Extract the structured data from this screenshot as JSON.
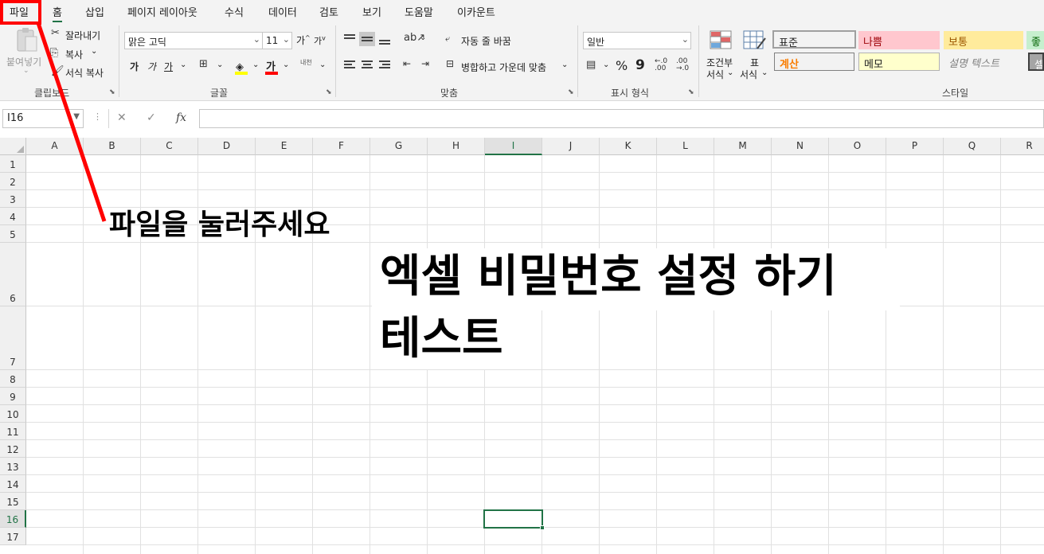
{
  "menu": {
    "tabs": [
      {
        "label": "파일"
      },
      {
        "label": "홈"
      },
      {
        "label": "삽입"
      },
      {
        "label": "페이지 레이아웃"
      },
      {
        "label": "수식"
      },
      {
        "label": "데이터"
      },
      {
        "label": "검토"
      },
      {
        "label": "보기"
      },
      {
        "label": "도움말"
      },
      {
        "label": "이카운트"
      }
    ],
    "active_tab": "홈"
  },
  "ribbon": {
    "clipboard": {
      "paste": "붙여넣기",
      "cut": "잘라내기",
      "copy": "복사",
      "format_painter": "서식 복사",
      "label": "클립보드"
    },
    "font": {
      "font_name": "맑은 고딕",
      "font_size": "11",
      "grow": "가",
      "shrink": "가",
      "bold": "가",
      "italic": "가",
      "underline": "가",
      "font_color_letter": "가",
      "phonetic": "내천",
      "label": "글꼴"
    },
    "alignment": {
      "wrap_text": "자동 줄 바꿈",
      "merge_center": "병합하고 가운데 맞춤",
      "label": "맞춤"
    },
    "number": {
      "format": "일반",
      "percent": "%",
      "comma": "9",
      "label": "표시 형식"
    },
    "styles": {
      "conditional": "조건부\n서식",
      "conditional_line1": "조건부",
      "conditional_line2": "서식",
      "table_line1": "표",
      "table_line2": "서식",
      "cells": [
        {
          "text": "표준",
          "bg": "#ffffff",
          "color": "#000000"
        },
        {
          "text": "나쁨",
          "bg": "#ffc7ce",
          "color": "#9c0006"
        },
        {
          "text": "보통",
          "bg": "#ffeb9c",
          "color": "#9c5700"
        },
        {
          "text": "좋",
          "bg": "#c6efce",
          "color": "#006100"
        },
        {
          "text": "계산",
          "bg": "#f2f2f2",
          "color": "#fa7d00"
        },
        {
          "text": "메모",
          "bg": "#ffffcc",
          "color": "#000000"
        },
        {
          "text": "설명 텍스트",
          "bg": "#ffffff",
          "color": "#7f7f7f"
        },
        {
          "text": "셀",
          "bg": "#a5a5a5",
          "color": "#ffffff"
        }
      ],
      "label": "스타일"
    }
  },
  "formula_bar": {
    "name_box": "I16",
    "cancel_symbol": "✕",
    "enter_symbol": "✓",
    "fx": "fx",
    "value": ""
  },
  "sheet": {
    "columns": [
      "A",
      "B",
      "C",
      "D",
      "E",
      "F",
      "G",
      "H",
      "I",
      "J",
      "K",
      "L",
      "M",
      "N",
      "O",
      "P",
      "Q",
      "R"
    ],
    "rows": [
      "1",
      "2",
      "3",
      "4",
      "5",
      "6",
      "7",
      "8",
      "9",
      "10",
      "11",
      "12",
      "13",
      "14",
      "15",
      "16",
      "17"
    ],
    "selected_column": "I",
    "selected_row": "16"
  },
  "overlay": {
    "instruction": "파일을 눌러주세요",
    "title_line1": "엑셀 비밀번호 설정 하기",
    "title_line2": "테스트",
    "highlight_color": "#ff0000"
  },
  "colors": {
    "accent": "#217346",
    "ribbon_bg": "#f3f3f3",
    "header_bg": "#f0f0f0"
  }
}
